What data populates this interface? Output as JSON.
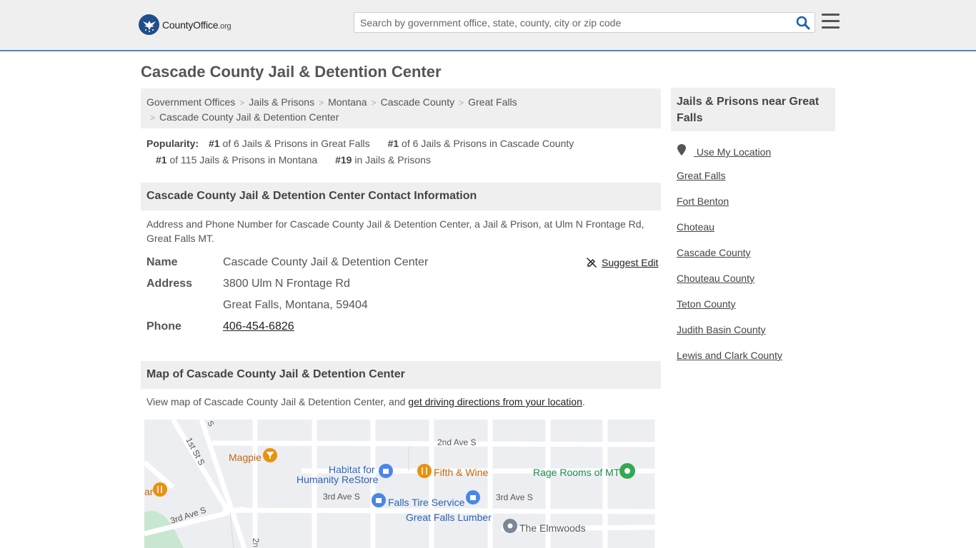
{
  "header": {
    "logo_name": "County",
    "logo_accent": "Office",
    "logo_tld": ".org",
    "search_placeholder": "Search by government office, state, county, city or zip code"
  },
  "page": {
    "title": "Cascade County Jail & Detention Center"
  },
  "breadcrumb": {
    "items": [
      "Government Offices",
      "Jails & Prisons",
      "Montana",
      "Cascade County",
      "Great Falls"
    ],
    "current": "Cascade County Jail & Detention Center"
  },
  "popularity": {
    "label": "Popularity:",
    "items": [
      {
        "rank": "#1",
        "text": "of 6 Jails & Prisons in Great Falls"
      },
      {
        "rank": "#1",
        "text": "of 6 Jails & Prisons in Cascade County"
      },
      {
        "rank": "#1",
        "text": "of 115 Jails & Prisons in Montana"
      },
      {
        "rank": "#19",
        "text": "in Jails & Prisons"
      }
    ]
  },
  "contact": {
    "heading": "Cascade County Jail & Detention Center Contact Information",
    "description": "Address and Phone Number for Cascade County Jail & Detention Center, a Jail & Prison, at Ulm N Frontage Rd, Great Falls MT.",
    "suggest_edit": "Suggest Edit",
    "name_label": "Name",
    "name_value": "Cascade County Jail & Detention Center",
    "address_label": "Address",
    "address_line1": "3800 Ulm N Frontage Rd",
    "address_line2": "Great Falls, Montana, 59404",
    "phone_label": "Phone",
    "phone_value": "406-454-6826"
  },
  "map_section": {
    "heading": "Map of Cascade County Jail & Detention Center",
    "desc_prefix": "View map of Cascade County Jail & Detention Center, and ",
    "desc_link": "get driving directions from your location",
    "desc_suffix": ".",
    "labels": {
      "magpie": "Magpie",
      "habitat1": "Habitat for",
      "habitat2": "Humanity ReStore",
      "fifth": "Fifth & Wine",
      "rage": "Rage Rooms of MT",
      "falls_tire": "Falls Tire Service",
      "lumber": "Great Falls Lumber",
      "elmwoods": "The Elmwoods",
      "ave2": "2nd Ave S",
      "ave3a": "3rd Ave S",
      "ave3b": "3rd Ave S",
      "ave3c": "3rd Ave S",
      "st1": "1st St S",
      "partial_ar": "ar",
      "partial_2n": "2n",
      "partial_s": "S"
    }
  },
  "sidebar": {
    "heading": "Jails & Prisons near Great Falls",
    "use_location": "Use My Location",
    "links": [
      "Great Falls",
      "Fort Benton",
      "Choteau",
      "Cascade County",
      "Chouteau County",
      "Teton County",
      "Judith Basin County",
      "Lewis and Clark County"
    ]
  }
}
